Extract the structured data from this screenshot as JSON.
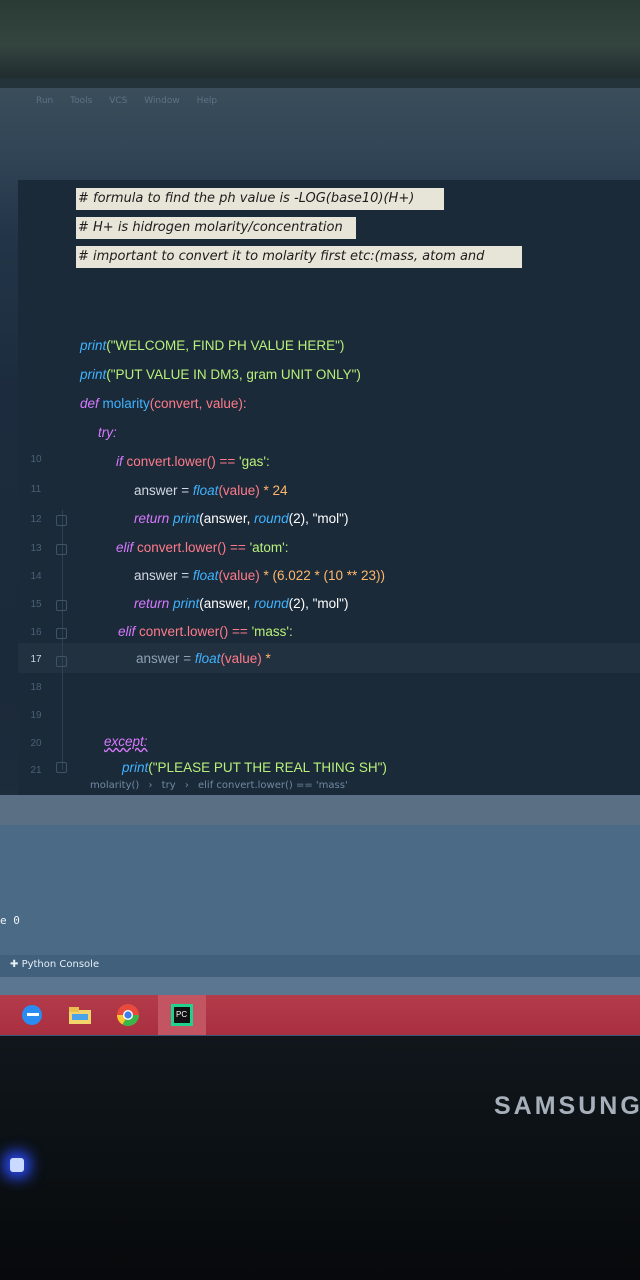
{
  "menubar": {
    "items": [
      "Run",
      "Tools",
      "VCS",
      "Window",
      "Help"
    ]
  },
  "editor": {
    "comments": [
      "# formula to find the ph value is -LOG(base10)(H+)",
      "# H+ is hidrogen molarity/concentration",
      "# important to convert it to molarity first etc:(mass, atom and"
    ],
    "line_numbers": [
      "10",
      "11",
      "12",
      "13",
      "14",
      "15",
      "16",
      "17",
      "18",
      "19",
      "20",
      "21"
    ],
    "code": {
      "l1_fn": "print",
      "l1_arg": "(\"WELCOME, FIND PH VALUE HERE\")",
      "l2_fn": "print",
      "l2_arg": "(\"PUT VALUE IN DM3, gram  UNIT ONLY\")",
      "l3_kw": "def",
      "l3_name": " molarity",
      "l3_args": "(convert, value):",
      "l4": "try:",
      "l5_kw": "if",
      "l5_rest": " convert.lower() == ",
      "l5_str": "'gas':",
      "l6_var": "answer = ",
      "l6_fn": "float",
      "l6_arg": "(value)",
      "l6_rest": " * 24",
      "l7_kw": "return",
      "l7_fn": " print",
      "l7_rest": "(answer, ",
      "l7_fn2": "round",
      "l7_rest2": "(2), \"mol\")",
      "l8_kw": "elif",
      "l8_rest": " convert.lower() == ",
      "l8_str": "'atom':",
      "l9_var": "answer = ",
      "l9_fn": "float",
      "l9_arg": "(value)",
      "l9_rest": " * (6.022 * (10 ** 23))",
      "l10_kw": "return",
      "l10_fn": " print",
      "l10_rest": "(answer, ",
      "l10_fn2": "round",
      "l10_rest2": "(2), \"mol\")",
      "l11_kw": "elif",
      "l11_rest": " convert.lower() == ",
      "l11_str": "'mass':",
      "l12_var": "answer = ",
      "l12_fn": "float",
      "l12_arg": "(value)",
      "l12_rest": " *",
      "l13": "except:",
      "l14_fn": "print",
      "l14_arg": "(\"PLEASE PUT THE REAL THING SH\")"
    },
    "breadcrumb": [
      "molarity()",
      "try",
      "elif convert.lower() == 'mass'"
    ]
  },
  "panels": {
    "side_label": "e 0",
    "python_console": "Python Console"
  },
  "monitor": {
    "brand": "SAMSUNG"
  },
  "colors": {
    "keyword": "#d779ff",
    "function": "#3fb3ff",
    "string": "#b8f07a",
    "number": "#ffb86b",
    "taskbar": "#b33b4a"
  },
  "taskbar": {
    "icons": [
      "edge-icon",
      "file-explorer-icon",
      "chrome-icon",
      "pycharm-icon"
    ]
  }
}
